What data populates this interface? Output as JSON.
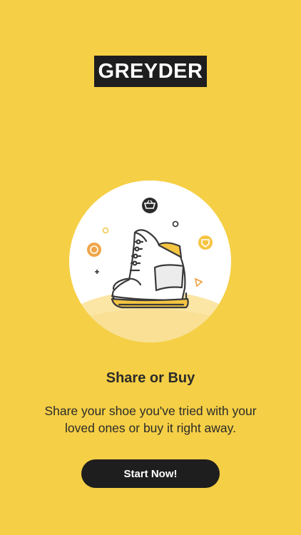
{
  "brand": {
    "logo_text": "GREYDER"
  },
  "onboarding": {
    "title": "Share or Buy",
    "description": "Share your shoe you've tried with your loved ones or buy it right away.",
    "cta_label": "Start Now!"
  },
  "colors": {
    "background": "#f5cf45",
    "dark": "#1e1e1e",
    "accent_orange": "#f0a64a",
    "accent_yellow": "#f5c542"
  },
  "icons": [
    "basket-icon",
    "orange-circle-icon",
    "yellow-badge-icon",
    "triangle-icon",
    "plus-icon",
    "ring-icon"
  ]
}
